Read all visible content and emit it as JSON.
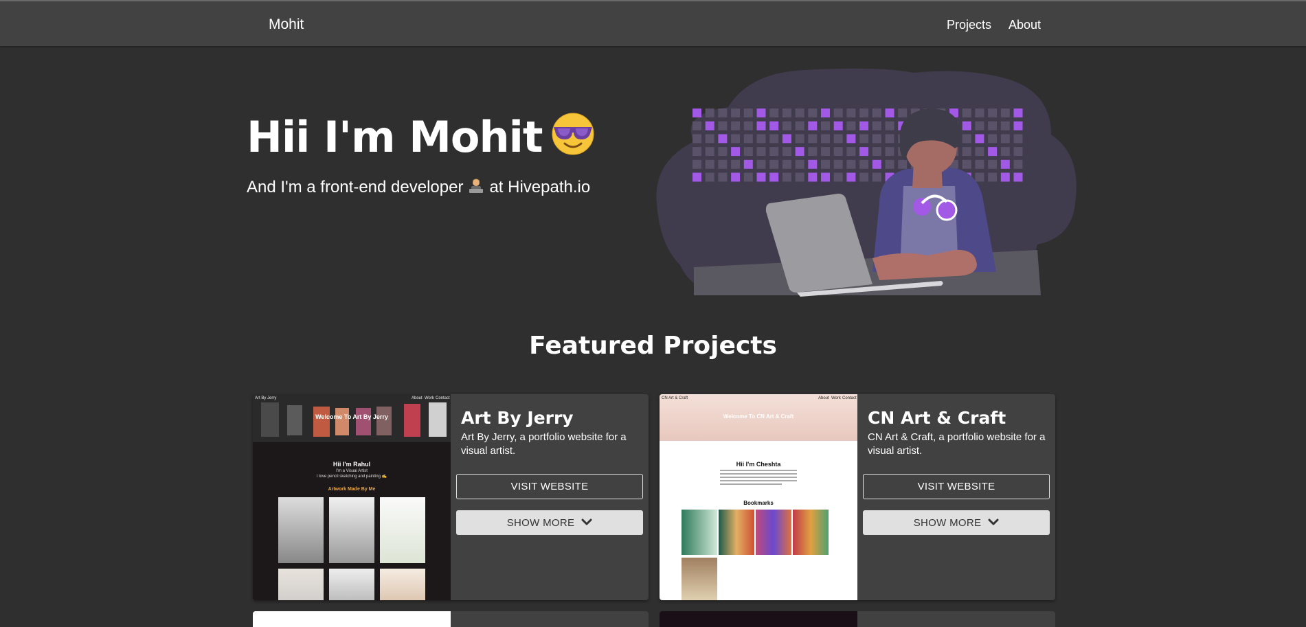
{
  "nav": {
    "brand": "Mohit",
    "links": [
      {
        "label": "Projects"
      },
      {
        "label": "About"
      }
    ]
  },
  "hero": {
    "title": "Hii I'm Mohit",
    "title_emoji": "smiling-face-with-sunglasses-icon",
    "subtitle_pre": "And I'm a front-end developer",
    "subtitle_emoji": "technologist-icon",
    "subtitle_post": "at Hivepath.io"
  },
  "section": {
    "title": "Featured Projects"
  },
  "projects": [
    {
      "title": "Art By Jerry",
      "description": "Art By Jerry, a portfolio website for a visual artist.",
      "visit_label": "VISIT WEBSITE",
      "more_label": "SHOW MORE",
      "thumb": {
        "brand": "Art By Jerry",
        "nav": [
          "About",
          "Work",
          "Contact"
        ],
        "banner": "Welcome To Art By Jerry",
        "greeting": "Hii I'm Rahul",
        "line1": "I'm a Visual Artist",
        "line2": "I love pencil sketching and painting ✍️",
        "section": "Artwork Made By Me"
      }
    },
    {
      "title": "CN Art & Craft",
      "description": "CN Art & Craft, a portfolio website for a visual artist.",
      "visit_label": "VISIT WEBSITE",
      "more_label": "SHOW MORE",
      "thumb": {
        "brand": "CN Art & Craft",
        "nav": [
          "About",
          "Work",
          "Contact"
        ],
        "banner": "Welcome To CN Art & Craft",
        "greeting": "Hii I'm Cheshta",
        "section": "Bookmarks"
      }
    }
  ],
  "colors": {
    "background": "#2f2f2f",
    "navbar": "#424242",
    "card": "#414141",
    "accent_purple": "#a259e6",
    "button_light": "#e0e0e0"
  }
}
